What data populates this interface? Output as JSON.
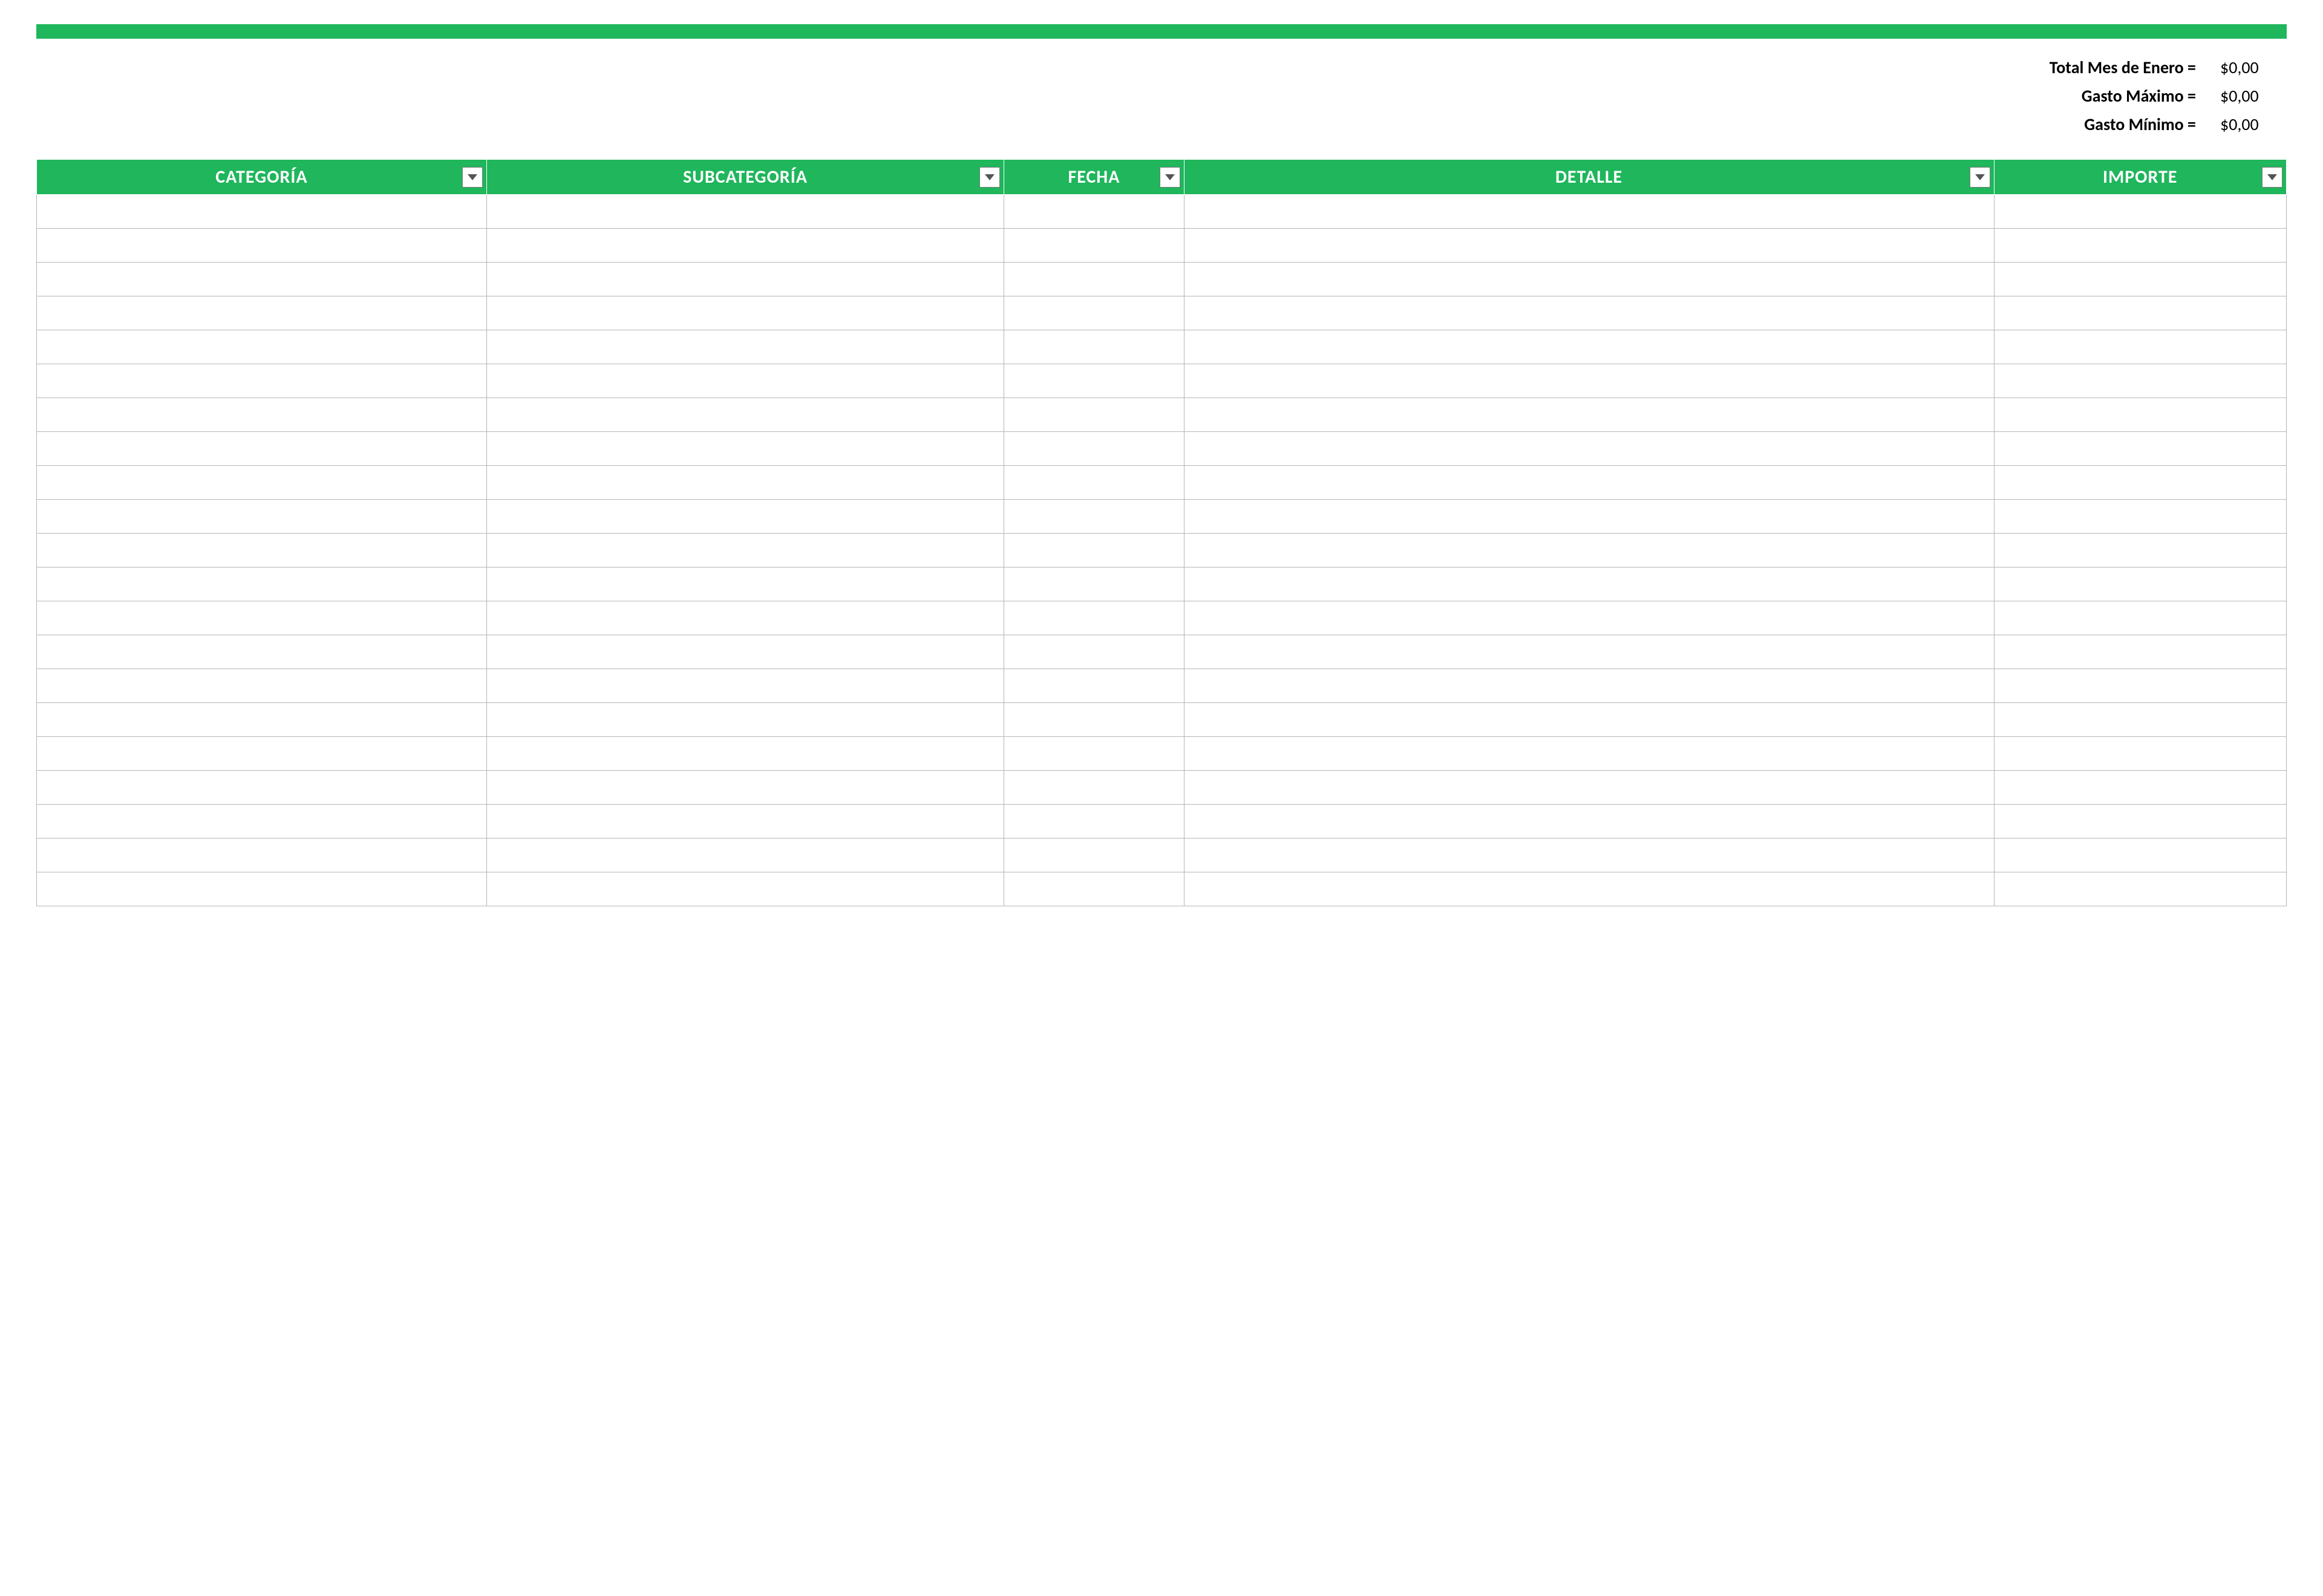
{
  "accent_color": "#1fb65c",
  "summary": [
    {
      "label": "Total Mes de Enero =",
      "value": "$0,00"
    },
    {
      "label": "Gasto Máximo =",
      "value": "$0,00"
    },
    {
      "label": "Gasto Mínimo =",
      "value": "$0,00"
    }
  ],
  "columns": [
    {
      "key": "categoria",
      "label": "CATEGORÍA"
    },
    {
      "key": "subcategoria",
      "label": "SUBCATEGORÍA"
    },
    {
      "key": "fecha",
      "label": "FECHA"
    },
    {
      "key": "detalle",
      "label": "DETALLE"
    },
    {
      "key": "importe",
      "label": "IMPORTE"
    }
  ],
  "rows": [
    {
      "categoria": "",
      "subcategoria": "",
      "fecha": "",
      "detalle": "",
      "importe": ""
    },
    {
      "categoria": "",
      "subcategoria": "",
      "fecha": "",
      "detalle": "",
      "importe": ""
    },
    {
      "categoria": "",
      "subcategoria": "",
      "fecha": "",
      "detalle": "",
      "importe": ""
    },
    {
      "categoria": "",
      "subcategoria": "",
      "fecha": "",
      "detalle": "",
      "importe": ""
    },
    {
      "categoria": "",
      "subcategoria": "",
      "fecha": "",
      "detalle": "",
      "importe": ""
    },
    {
      "categoria": "",
      "subcategoria": "",
      "fecha": "",
      "detalle": "",
      "importe": ""
    },
    {
      "categoria": "",
      "subcategoria": "",
      "fecha": "",
      "detalle": "",
      "importe": ""
    },
    {
      "categoria": "",
      "subcategoria": "",
      "fecha": "",
      "detalle": "",
      "importe": ""
    },
    {
      "categoria": "",
      "subcategoria": "",
      "fecha": "",
      "detalle": "",
      "importe": ""
    },
    {
      "categoria": "",
      "subcategoria": "",
      "fecha": "",
      "detalle": "",
      "importe": ""
    },
    {
      "categoria": "",
      "subcategoria": "",
      "fecha": "",
      "detalle": "",
      "importe": ""
    },
    {
      "categoria": "",
      "subcategoria": "",
      "fecha": "",
      "detalle": "",
      "importe": ""
    },
    {
      "categoria": "",
      "subcategoria": "",
      "fecha": "",
      "detalle": "",
      "importe": ""
    },
    {
      "categoria": "",
      "subcategoria": "",
      "fecha": "",
      "detalle": "",
      "importe": ""
    },
    {
      "categoria": "",
      "subcategoria": "",
      "fecha": "",
      "detalle": "",
      "importe": ""
    },
    {
      "categoria": "",
      "subcategoria": "",
      "fecha": "",
      "detalle": "",
      "importe": ""
    },
    {
      "categoria": "",
      "subcategoria": "",
      "fecha": "",
      "detalle": "",
      "importe": ""
    },
    {
      "categoria": "",
      "subcategoria": "",
      "fecha": "",
      "detalle": "",
      "importe": ""
    },
    {
      "categoria": "",
      "subcategoria": "",
      "fecha": "",
      "detalle": "",
      "importe": ""
    },
    {
      "categoria": "",
      "subcategoria": "",
      "fecha": "",
      "detalle": "",
      "importe": ""
    },
    {
      "categoria": "",
      "subcategoria": "",
      "fecha": "",
      "detalle": "",
      "importe": ""
    }
  ]
}
